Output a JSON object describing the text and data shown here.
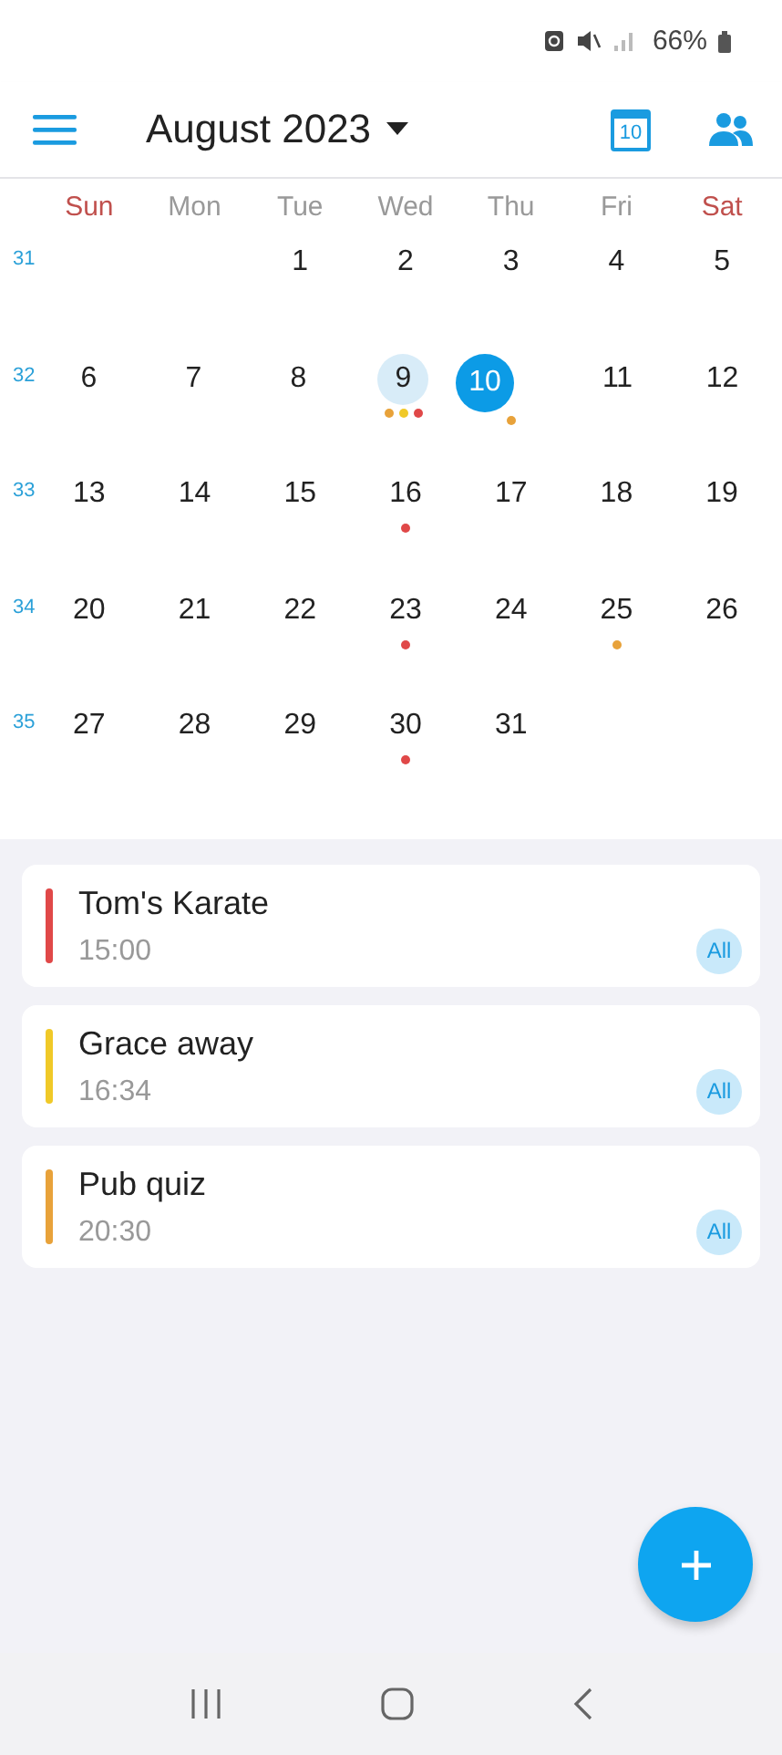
{
  "status_bar": {
    "battery": "66%"
  },
  "toolbar": {
    "title": "August 2023",
    "today_icon_day": "10"
  },
  "weekdays": [
    {
      "label": "Sun",
      "weekend": true
    },
    {
      "label": "Mon",
      "weekend": false
    },
    {
      "label": "Tue",
      "weekend": false
    },
    {
      "label": "Wed",
      "weekend": false
    },
    {
      "label": "Thu",
      "weekend": false
    },
    {
      "label": "Fri",
      "weekend": false
    },
    {
      "label": "Sat",
      "weekend": true
    }
  ],
  "weeks": [
    {
      "week": "31",
      "days": [
        {
          "kind": "blank"
        },
        {
          "kind": "blank"
        },
        {
          "kind": "day",
          "day": "1",
          "selected": false,
          "today": false
        },
        {
          "kind": "day",
          "day": "2",
          "selected": false,
          "today": false
        },
        {
          "kind": "day",
          "day": "3",
          "selected": false,
          "today": false
        },
        {
          "kind": "day",
          "day": "4",
          "selected": false,
          "today": false
        },
        {
          "kind": "day",
          "day": "5",
          "selected": false,
          "today": false
        }
      ]
    },
    {
      "week": "32",
      "days": [
        {
          "kind": "day",
          "day": "6",
          "selected": false,
          "today": false
        },
        {
          "kind": "day",
          "day": "7",
          "selected": false,
          "today": false
        },
        {
          "kind": "day",
          "day": "8",
          "selected": false,
          "today": false
        },
        {
          "kind": "day",
          "day": "9",
          "selected": true,
          "today": false,
          "dots": [
            {
              "color": "#e8a23a"
            },
            {
              "color": "#f0c928"
            },
            {
              "color": "#e04848"
            }
          ]
        },
        {
          "kind": "day",
          "day": "10",
          "selected": false,
          "today": true,
          "dots": [
            {
              "color": "#e8a23a"
            }
          ]
        },
        {
          "kind": "day",
          "day": "11",
          "selected": false,
          "today": false
        },
        {
          "kind": "day",
          "day": "12",
          "selected": false,
          "today": false
        }
      ]
    },
    {
      "week": "33",
      "days": [
        {
          "kind": "day",
          "day": "13",
          "selected": false,
          "today": false
        },
        {
          "kind": "day",
          "day": "14",
          "selected": false,
          "today": false
        },
        {
          "kind": "day",
          "day": "15",
          "selected": false,
          "today": false
        },
        {
          "kind": "day",
          "day": "16",
          "selected": false,
          "today": false,
          "dots": [
            {
              "color": "#e04848"
            }
          ]
        },
        {
          "kind": "day",
          "day": "17",
          "selected": false,
          "today": false
        },
        {
          "kind": "day",
          "day": "18",
          "selected": false,
          "today": false
        },
        {
          "kind": "day",
          "day": "19",
          "selected": false,
          "today": false
        }
      ]
    },
    {
      "week": "34",
      "days": [
        {
          "kind": "day",
          "day": "20",
          "selected": false,
          "today": false
        },
        {
          "kind": "day",
          "day": "21",
          "selected": false,
          "today": false
        },
        {
          "kind": "day",
          "day": "22",
          "selected": false,
          "today": false
        },
        {
          "kind": "day",
          "day": "23",
          "selected": false,
          "today": false,
          "dots": [
            {
              "color": "#e04848"
            }
          ]
        },
        {
          "kind": "day",
          "day": "24",
          "selected": false,
          "today": false
        },
        {
          "kind": "day",
          "day": "25",
          "selected": false,
          "today": false,
          "dots": [
            {
              "color": "#e8a23a"
            }
          ]
        },
        {
          "kind": "day",
          "day": "26",
          "selected": false,
          "today": false
        }
      ]
    },
    {
      "week": "35",
      "days": [
        {
          "kind": "day",
          "day": "27",
          "selected": false,
          "today": false
        },
        {
          "kind": "day",
          "day": "28",
          "selected": false,
          "today": false
        },
        {
          "kind": "day",
          "day": "29",
          "selected": false,
          "today": false
        },
        {
          "kind": "day",
          "day": "30",
          "selected": false,
          "today": false,
          "dots": [
            {
              "color": "#e04848"
            }
          ]
        },
        {
          "kind": "day",
          "day": "31",
          "selected": false,
          "today": false
        },
        {
          "kind": "blank"
        },
        {
          "kind": "blank"
        }
      ]
    }
  ],
  "events": [
    {
      "title": "Tom's Karate",
      "time": "15:00",
      "badge": "All",
      "color": "#e04848"
    },
    {
      "title": "Grace away",
      "time": "16:34",
      "badge": "All",
      "color": "#f0c928"
    },
    {
      "title": "Pub quiz",
      "time": "20:30",
      "badge": "All",
      "color": "#e8a23a"
    }
  ]
}
